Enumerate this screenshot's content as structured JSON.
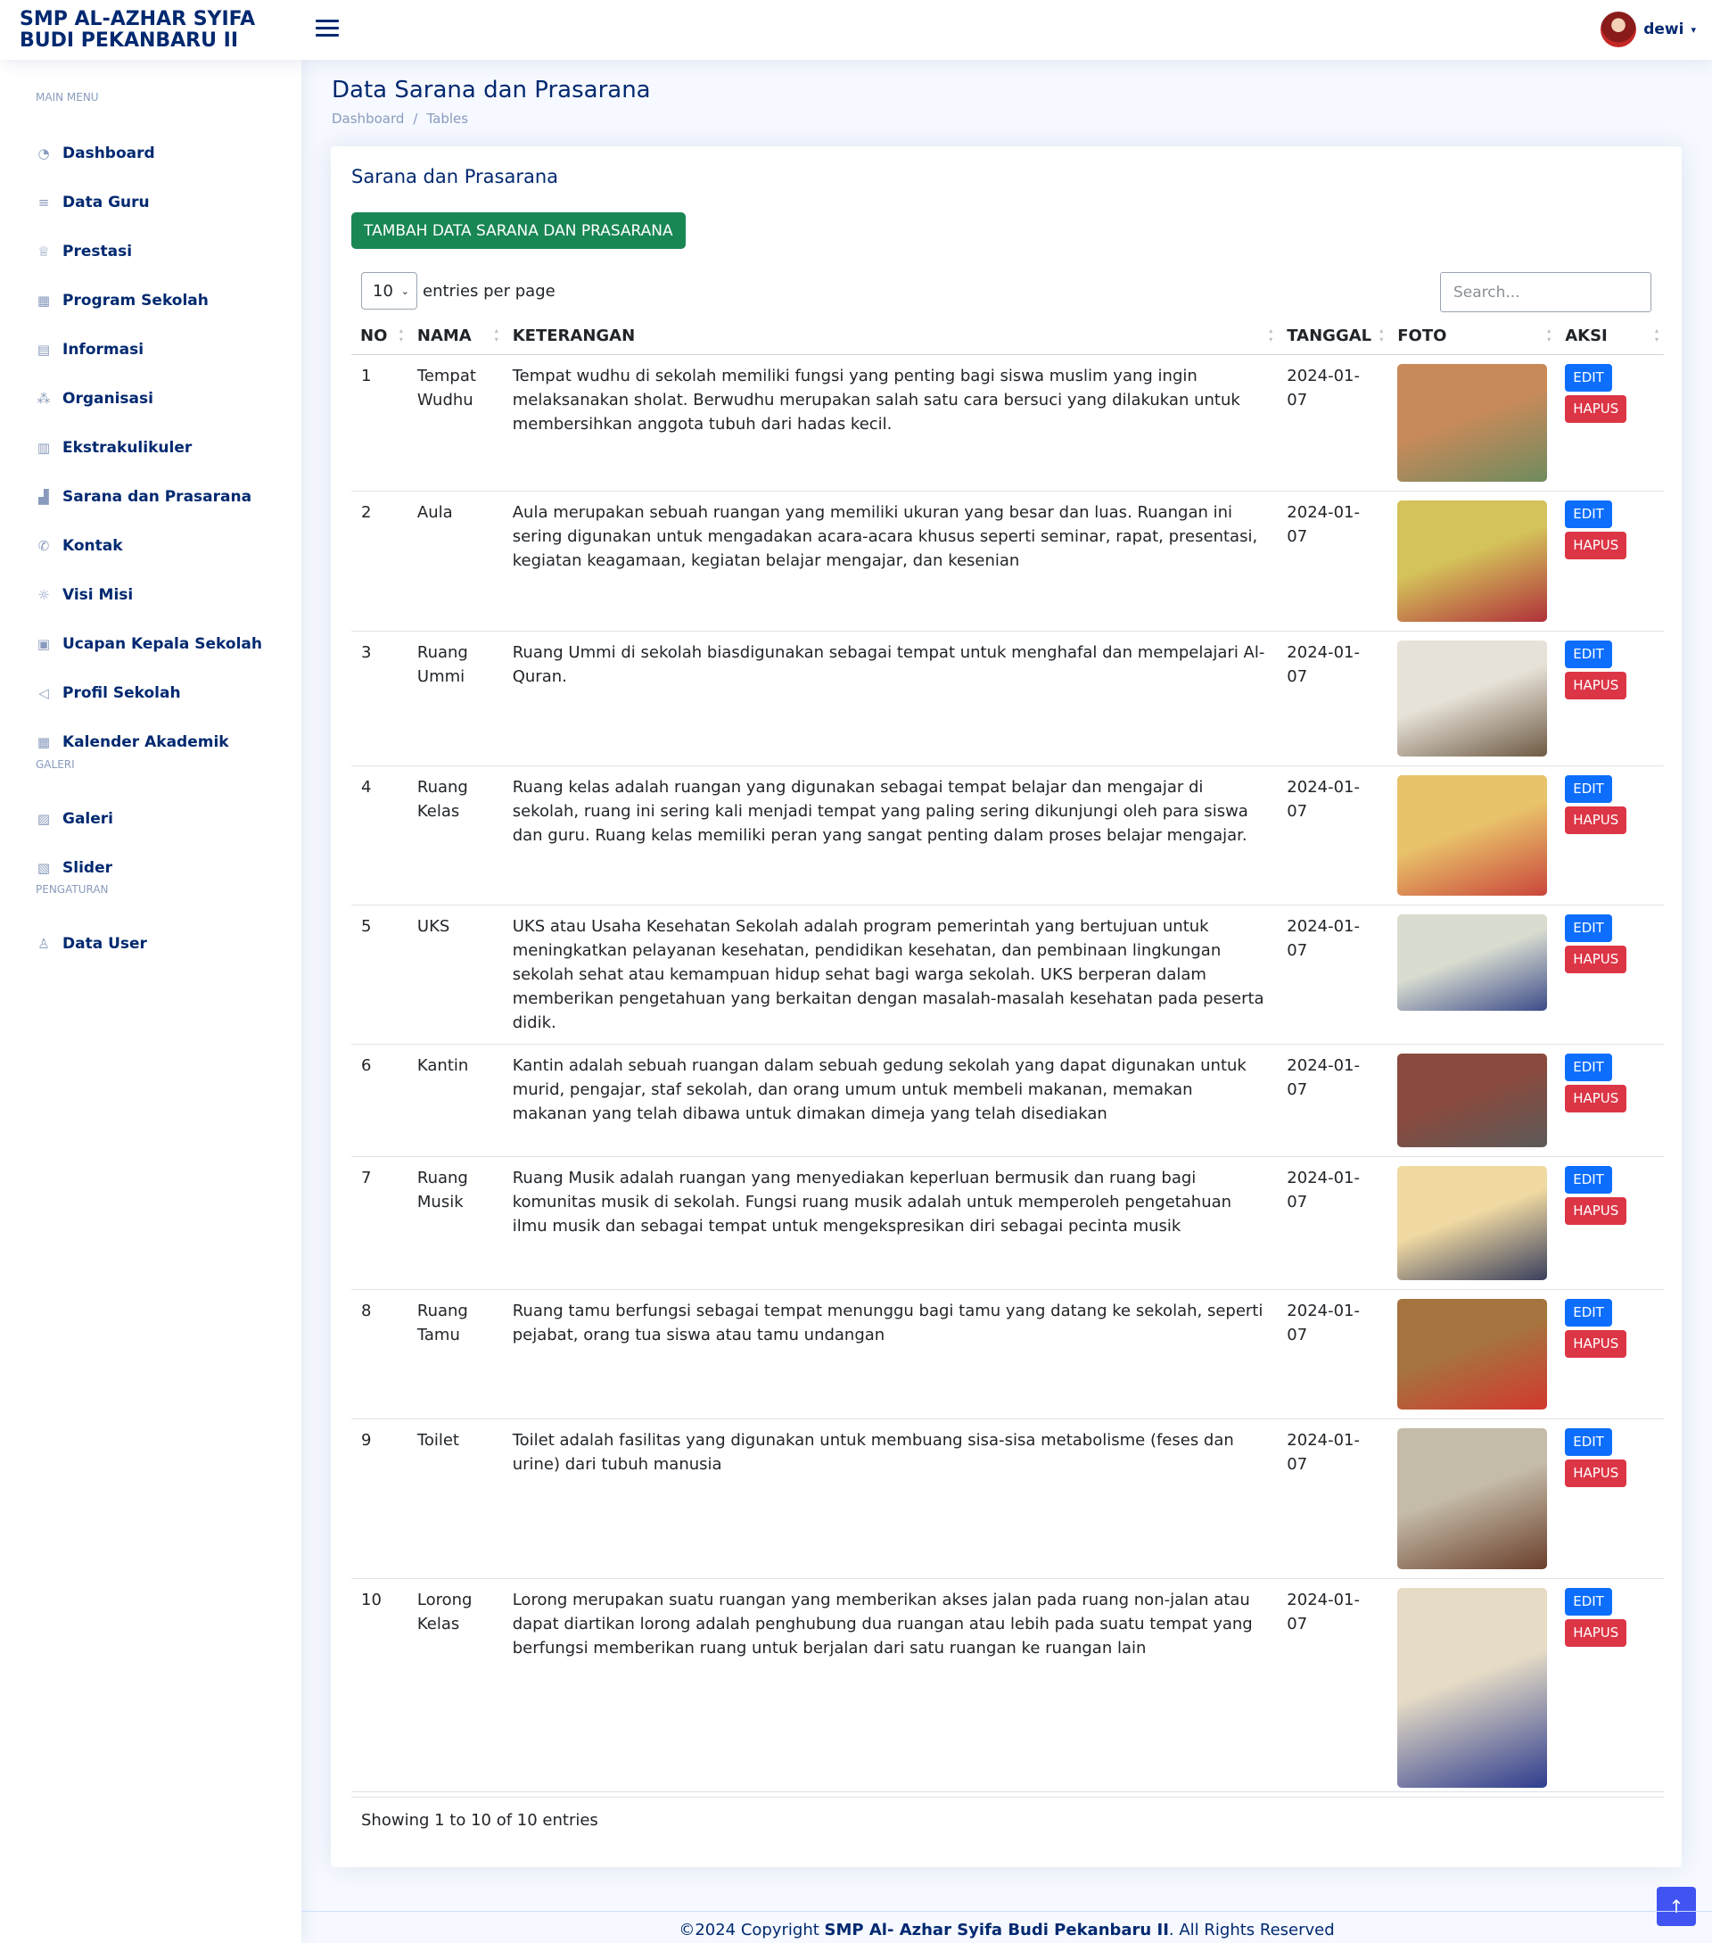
{
  "header": {
    "logo": "SMP AL-AZHAR SYIFA BUDI PEKANBARU II",
    "user": "dewi"
  },
  "sidebar": {
    "headings": [
      "MAIN MENU",
      "GALERI",
      "PENGATURAN"
    ],
    "items": [
      {
        "label": "Dashboard",
        "icon": "speedometer-icon",
        "glyph": "◔"
      },
      {
        "label": "Data Guru",
        "icon": "database-icon",
        "glyph": "≡"
      },
      {
        "label": "Prestasi",
        "icon": "trophy-icon",
        "glyph": "♕"
      },
      {
        "label": "Program Sekolah",
        "icon": "building-icon",
        "glyph": "▦"
      },
      {
        "label": "Informasi",
        "icon": "newspaper-icon",
        "glyph": "▤"
      },
      {
        "label": "Organisasi",
        "icon": "diagram-icon",
        "glyph": "⁂"
      },
      {
        "label": "Ekstrakulikuler",
        "icon": "calculator-icon",
        "glyph": "▥"
      },
      {
        "label": "Sarana dan Prasarana",
        "icon": "bar-chart-icon",
        "glyph": "▟"
      },
      {
        "label": "Kontak",
        "icon": "telephone-icon",
        "glyph": "✆"
      },
      {
        "label": "Visi Misi",
        "icon": "lightbulb-icon",
        "glyph": "☼"
      },
      {
        "label": "Ucapan Kepala Sekolah",
        "icon": "person-square-icon",
        "glyph": "▣"
      },
      {
        "label": "Profil Sekolah",
        "icon": "megaphone-icon",
        "glyph": "◁"
      },
      {
        "label": "Kalender Akademik",
        "icon": "calendar-icon",
        "glyph": "▦"
      },
      {
        "label": "Galeri",
        "icon": "image-icon",
        "glyph": "▨"
      },
      {
        "label": "Slider",
        "icon": "images-icon",
        "glyph": "▧"
      },
      {
        "label": "Data User",
        "icon": "person-icon",
        "glyph": "♙"
      }
    ]
  },
  "page": {
    "title": "Data Sarana dan Prasarana",
    "breadcrumb": [
      "Dashboard",
      "/",
      "Tables"
    ]
  },
  "card": {
    "title": "Sarana dan Prasarana",
    "add_button": "TAMBAH DATA SARANA DAN PRASARANA",
    "entries_value": "10",
    "entries_label": "entries per page",
    "search_placeholder": "Search...",
    "columns": [
      "NO",
      "NAMA",
      "KETERANGAN",
      "TANGGAL",
      "FOTO",
      "AKSI"
    ],
    "edit_label": "EDIT",
    "delete_label": "HAPUS",
    "showing": "Showing 1 to 10 of 10 entries",
    "rows": [
      {
        "no": "1",
        "nama": "Tempat Wudhu",
        "ket": "Tempat wudhu di sekolah memiliki fungsi yang penting bagi siswa muslim yang ingin melaksanakan sholat. Berwudhu merupakan salah satu cara bersuci yang dilakukan untuk membersihkan anggota tubuh dari hadas kecil.",
        "tanggal": "2024-01-07",
        "c1": "#c98a5a",
        "c2": "#6f8b5e"
      },
      {
        "no": "2",
        "nama": "Aula",
        "ket": "Aula merupakan sebuah ruangan yang memiliki ukuran yang besar dan luas. Ruangan ini sering digunakan untuk mengadakan acara-acara khusus seperti seminar, rapat, presentasi, kegiatan keagamaan, kegiatan belajar mengajar, dan kesenian",
        "tanggal": "2024-01-07",
        "c1": "#d4c25a",
        "c2": "#b0313a"
      },
      {
        "no": "3",
        "nama": "Ruang Ummi",
        "ket": "Ruang Ummi di sekolah biasdigunakan sebagai tempat untuk menghafal dan mempelajari Al-Quran.",
        "tanggal": "2024-01-07",
        "c1": "#e7e2d8",
        "c2": "#6e5a44"
      },
      {
        "no": "4",
        "nama": "Ruang Kelas",
        "ket": "Ruang kelas adalah ruangan yang digunakan sebagai tempat belajar dan mengajar di sekolah, ruang ini sering kali menjadi tempat yang paling sering dikunjungi oleh para siswa dan guru. Ruang kelas memiliki peran yang sangat penting dalam proses belajar mengajar.",
        "tanggal": "2024-01-07",
        "c1": "#e9c36a",
        "c2": "#c9463b"
      },
      {
        "no": "5",
        "nama": "UKS",
        "ket": "UKS atau Usaha Kesehatan Sekolah adalah program pemerintah yang bertujuan untuk meningkatkan pelayanan kesehatan, pendidikan kesehatan, dan pembinaan lingkungan sekolah sehat atau kemampuan hidup sehat bagi warga sekolah. UKS berperan dalam memberikan pengetahuan yang berkaitan dengan masalah-masalah kesehatan pada peserta didik.",
        "tanggal": "2024-01-07",
        "c1": "#d9ddd0",
        "c2": "#3d4c8a"
      },
      {
        "no": "6",
        "nama": "Kantin",
        "ket": "Kantin adalah sebuah ruangan dalam sebuah gedung sekolah yang dapat digunakan untuk murid, pengajar, staf sekolah, dan orang umum untuk membeli makanan, memakan makanan yang telah dibawa untuk dimakan dimeja yang telah disediakan",
        "tanggal": "2024-01-07",
        "c1": "#8a4a3e",
        "c2": "#5c5a58"
      },
      {
        "no": "7",
        "nama": "Ruang Musik",
        "ket": "Ruang Musik adalah ruangan yang menyediakan keperluan bermusik dan ruang bagi komunitas musik di sekolah. Fungsi ruang musik adalah untuk memperoleh pengetahuan ilmu musik dan sebagai tempat untuk mengekspresikan diri sebagai pecinta musik",
        "tanggal": "2024-01-07",
        "c1": "#f0d9a2",
        "c2": "#3a3f5c"
      },
      {
        "no": "8",
        "nama": "Ruang Tamu",
        "ket": "Ruang tamu berfungsi sebagai tempat menunggu bagi tamu yang datang ke sekolah, seperti pejabat, orang tua siswa atau tamu undangan",
        "tanggal": "2024-01-07",
        "c1": "#a6743e",
        "c2": "#d2382f"
      },
      {
        "no": "9",
        "nama": "Toilet",
        "ket": "Toilet adalah fasilitas yang digunakan untuk membuang sisa-sisa metabolisme (feses dan urine) dari tubuh manusia",
        "tanggal": "2024-01-07",
        "c1": "#c4bba8",
        "c2": "#6a3f2b"
      },
      {
        "no": "10",
        "nama": "Lorong Kelas",
        "ket": "Lorong merupakan suatu ruangan yang memberikan akses jalan pada ruang non-jalan atau dapat diartikan lorong adalah penghubung dua ruangan atau lebih pada suatu tempat yang berfungsi memberikan ruang untuk berjalan dari satu ruangan ke ruangan lain",
        "tanggal": "2024-01-07",
        "c1": "#e6dcc6",
        "c2": "#2f3d8e"
      }
    ]
  },
  "footer": {
    "prefix": "©2024 Copyright ",
    "brand": "SMP Al- Azhar Syifa Budi Pekanbaru II",
    "suffix": ". All Rights Reserved"
  },
  "colors": {
    "primary": "#012970",
    "success": "#198754",
    "edit": "#0d6efd",
    "delete": "#dc3545"
  }
}
